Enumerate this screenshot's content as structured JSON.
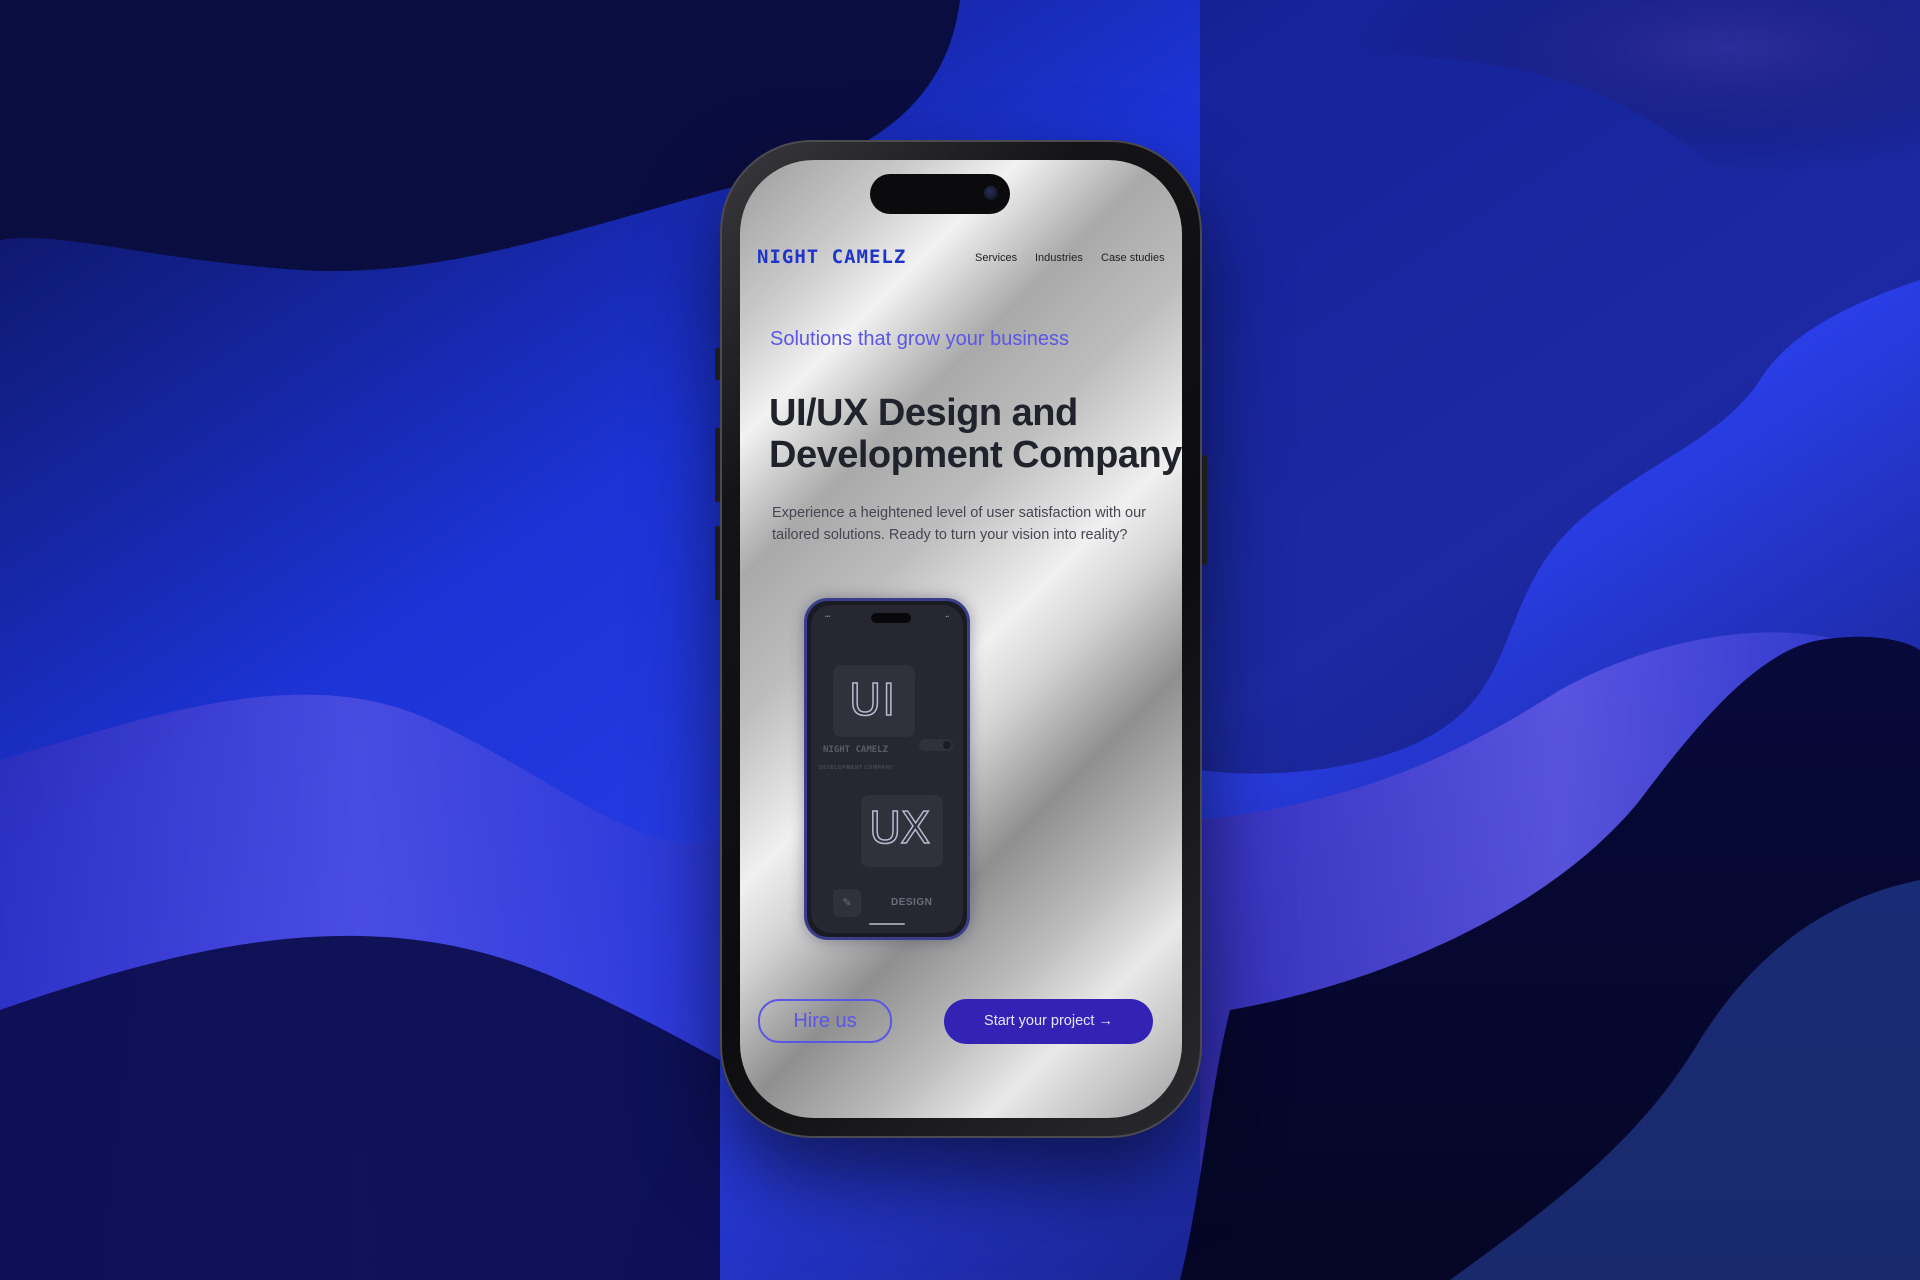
{
  "colors": {
    "brand": "#1f35c9",
    "accent": "#5a56e6",
    "primary_button": "#3323b4",
    "heading": "#20222c"
  },
  "site": {
    "logo": "NIGHT CAMELZ",
    "nav": [
      "Services",
      "Industries",
      "Case studies"
    ]
  },
  "hero": {
    "tagline": "Solutions that grow your business",
    "headline_line1": "UI/UX Design and",
    "headline_line2": "Development Company",
    "description": "Experience a heightened level of user satisfaction with our tailored solutions. Ready to turn your vision into reality?"
  },
  "mockup": {
    "ui_text": "UI",
    "ux_text": "UX",
    "brand_text": "NIGHT CAMELZ",
    "subtitle": "DEVELOPMENT COMPANY",
    "design_label": "DESIGN",
    "pen_icon": "pen-icon"
  },
  "buttons": {
    "hire": "Hire us",
    "start": "Start your project →"
  }
}
